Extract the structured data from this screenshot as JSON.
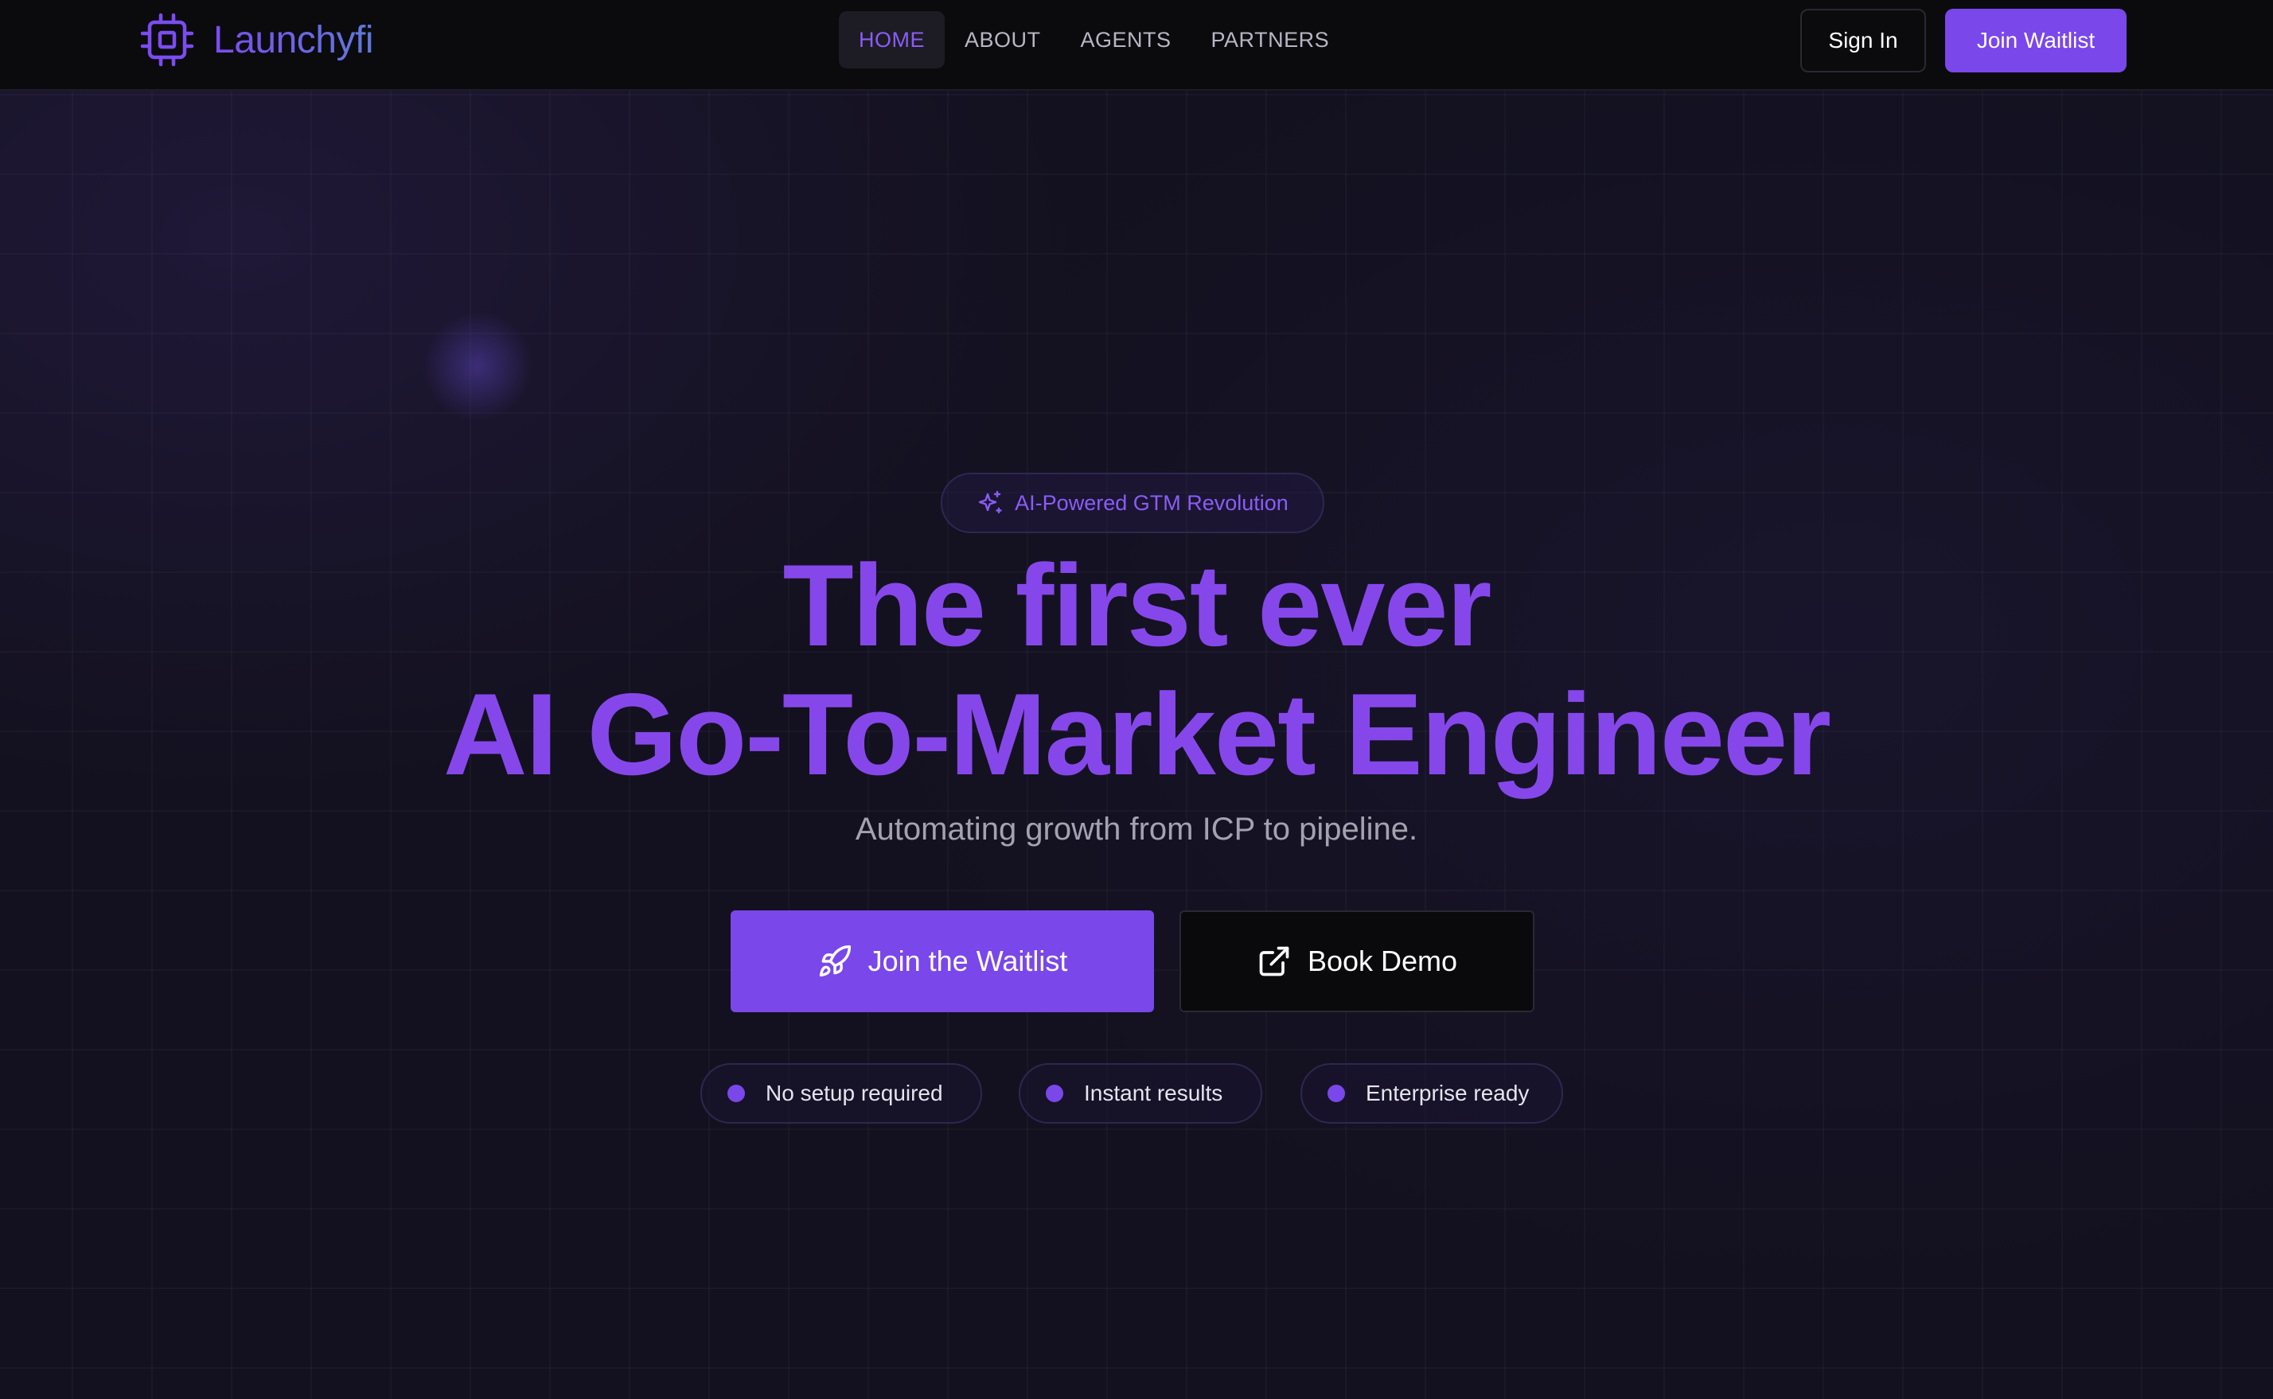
{
  "brand": {
    "name": "Launchyfi",
    "icon": "chip-icon"
  },
  "nav": {
    "links": [
      {
        "label": "HOME",
        "active": true
      },
      {
        "label": "ABOUT",
        "active": false
      },
      {
        "label": "AGENTS",
        "active": false
      },
      {
        "label": "PARTNERS",
        "active": false
      }
    ],
    "signin_label": "Sign In",
    "join_label": "Join Waitlist"
  },
  "hero": {
    "badge": {
      "label": "AI-Powered GTM Revolution",
      "icon": "sparkles-icon"
    },
    "title_line1": "The first ever",
    "title_line2": "AI Go-To-Market Engineer",
    "subtitle": "Automating growth from ICP to pipeline.",
    "primary_button": {
      "label": "Join the Waitlist",
      "icon": "rocket-icon"
    },
    "secondary_button": {
      "label": "Book Demo",
      "icon": "external-link-icon"
    },
    "features": [
      {
        "label": "No setup required"
      },
      {
        "label": "Instant results"
      },
      {
        "label": "Enterprise ready"
      }
    ]
  },
  "colors": {
    "accent": "#7a47ea",
    "title": "#8647ea",
    "background": "#13111f",
    "navbar": "#0b0b0e"
  }
}
